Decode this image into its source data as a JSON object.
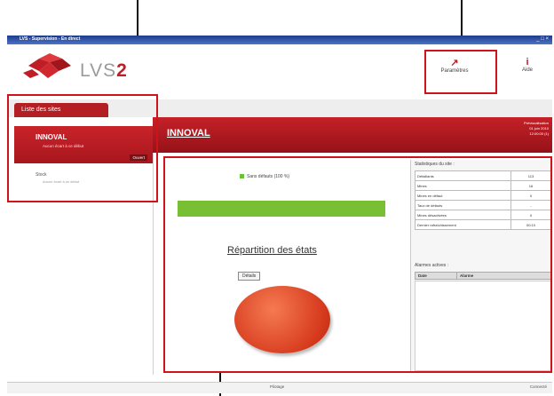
{
  "window": {
    "title": "LVS - Supervision - En direct",
    "controls": "_ □ ×"
  },
  "app": {
    "logo_text": "LVS",
    "logo_accent": "2"
  },
  "toolbar": {
    "params": {
      "icon": "wrench-icon",
      "glyph": "↗",
      "label": "Paramètres"
    },
    "help": {
      "icon": "info-icon",
      "glyph": "i",
      "label": "Aide"
    }
  },
  "tabs": {
    "sites_list": "Liste des sites"
  },
  "sidebar": {
    "selected": {
      "name": "INNOVAL",
      "sub": "Aucun écart à ce début",
      "badge": "Ouvert"
    },
    "other": {
      "name": "Stock",
      "sub": "Aucun écart à ce début"
    }
  },
  "banner": {
    "title": "INNOVAL",
    "right_lines": [
      "Prévisualisation",
      "01 juin 2010",
      "12:00:00 (1)"
    ]
  },
  "main": {
    "legend": "Sans défauts (100 %)",
    "progress_percent": 100,
    "chart_title": "Répartition des états",
    "chart_button": "Détails"
  },
  "chart_data": {
    "type": "pie",
    "title": "Répartition des états",
    "slices": [
      {
        "label": "Sans défauts",
        "value": 100,
        "color": "#e04a26"
      }
    ]
  },
  "stats": {
    "heading": "Statistiques du site :",
    "rows": [
      {
        "label": "Défaillants",
        "value": "113"
      },
      {
        "label": "Mines",
        "value": "16"
      },
      {
        "label": "Mines en défaut",
        "value": "0"
      },
      {
        "label": "Taux de défauts",
        "value": "-"
      },
      {
        "label": "Mines désactivées",
        "value": "0"
      },
      {
        "label": "Dernier rafraîchissement",
        "value": "00:10"
      }
    ]
  },
  "alarms": {
    "heading": "Alarmes actives :",
    "col_date": "Date",
    "col_alarm": "Alarme"
  },
  "statusbar": {
    "center": "Pilotage",
    "right": "Connecté"
  },
  "colors": {
    "brand": "#c01e26",
    "progress": "#78bf34",
    "pie": "#e04a26"
  }
}
